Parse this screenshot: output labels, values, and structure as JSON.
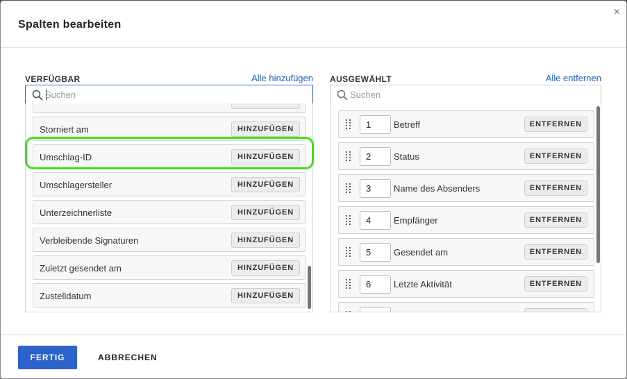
{
  "dialog": {
    "title": "Spalten bearbeiten",
    "close_symbol": "×"
  },
  "available": {
    "heading": "VERFÜGBAR",
    "add_all_label": "Alle hinzufügen",
    "search_placeholder": "Suchen",
    "add_label": "HINZUFÜGEN",
    "items": [
      {
        "label": ""
      },
      {
        "label": "Storniert am"
      },
      {
        "label": "Umschlag-ID"
      },
      {
        "label": "Umschlagersteller"
      },
      {
        "label": "Unterzeichnerliste"
      },
      {
        "label": "Verbleibende Signaturen"
      },
      {
        "label": "Zuletzt gesendet am"
      },
      {
        "label": "Zustelldatum"
      }
    ]
  },
  "selected": {
    "heading": "AUSGEWÄHLT",
    "remove_all_label": "Alle entfernen",
    "search_placeholder": "Suchen",
    "remove_label": "ENTFERNEN",
    "items": [
      {
        "order": "1",
        "label": "Betreff"
      },
      {
        "order": "2",
        "label": "Status"
      },
      {
        "order": "3",
        "label": "Name des Absenders"
      },
      {
        "order": "4",
        "label": "Empfänger"
      },
      {
        "order": "5",
        "label": "Gesendet am"
      },
      {
        "order": "6",
        "label": "Letzte Aktivität"
      },
      {
        "order": "",
        "label": ""
      }
    ]
  },
  "footer": {
    "done_label": "FERTIG",
    "cancel_label": "ABBRECHEN"
  },
  "colors": {
    "primary": "#2a63c9",
    "highlight": "#3ee01b",
    "link": "#1a5fc7"
  }
}
